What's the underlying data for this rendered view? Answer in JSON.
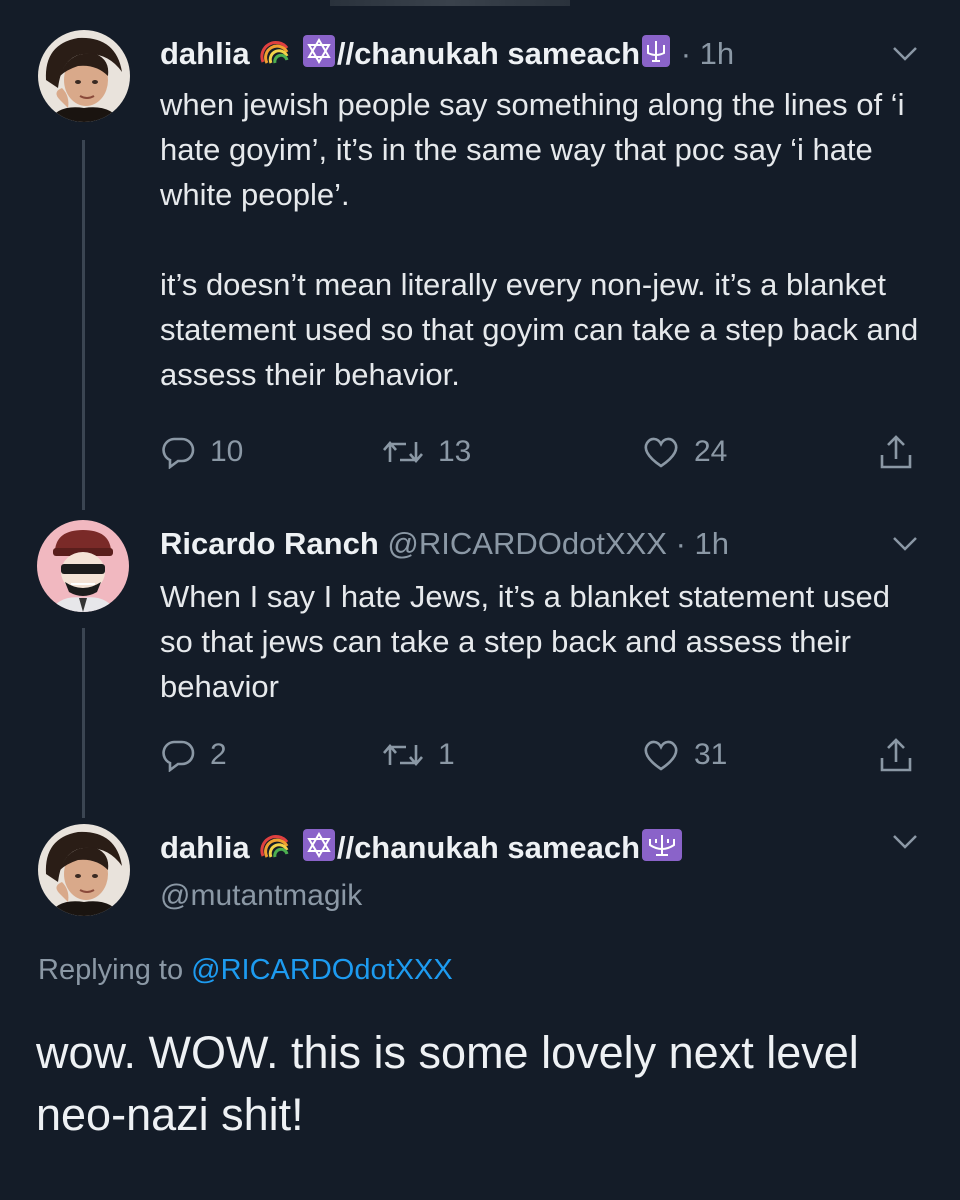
{
  "tweets": [
    {
      "display_name": "dahlia",
      "name_suffix": "//chanukah sameach",
      "time": "· 1h",
      "paragraphs": [
        "when jewish people say something along the lines of ‘i hate goyim’, it’s in the same way that poc say ‘i hate white people’.",
        "it’s doesn’t mean literally every non-jew. it’s a blanket statement used so that goyim can take a step back and assess their behavior."
      ],
      "replies": "10",
      "retweets": "13",
      "likes": "24"
    },
    {
      "display_name": "Ricardo Ranch",
      "handle_time": "@RICARDOdotXXX · 1h",
      "paragraphs": [
        "When I say I hate Jews, it’s a blanket statement used so that jews can take a step back and assess their behavior"
      ],
      "replies": "2",
      "retweets": "1",
      "likes": "31"
    }
  ],
  "main_tweet": {
    "display_name": "dahlia",
    "name_suffix": "//chanukah sameach",
    "handle": "@mutantmagik",
    "replying_prefix": "Replying to",
    "replying_to": "@RICARDOdotXXX",
    "text": "wow. WOW. this is some lovely next level neo-nazi shit!"
  },
  "icons": {
    "reply": "reply-icon",
    "retweet": "retweet-icon",
    "like": "heart-icon",
    "share": "share-icon",
    "caret": "chevron-down-icon",
    "rainbow": "rainbow-emoji",
    "star": "star-of-david-emoji",
    "menorah": "menorah-emoji"
  },
  "colors": {
    "background": "#141c28",
    "text_primary": "#eef1f4",
    "text_secondary": "#8b98a5",
    "link": "#1d9bf0",
    "emoji_purple": "#8a63c9"
  }
}
